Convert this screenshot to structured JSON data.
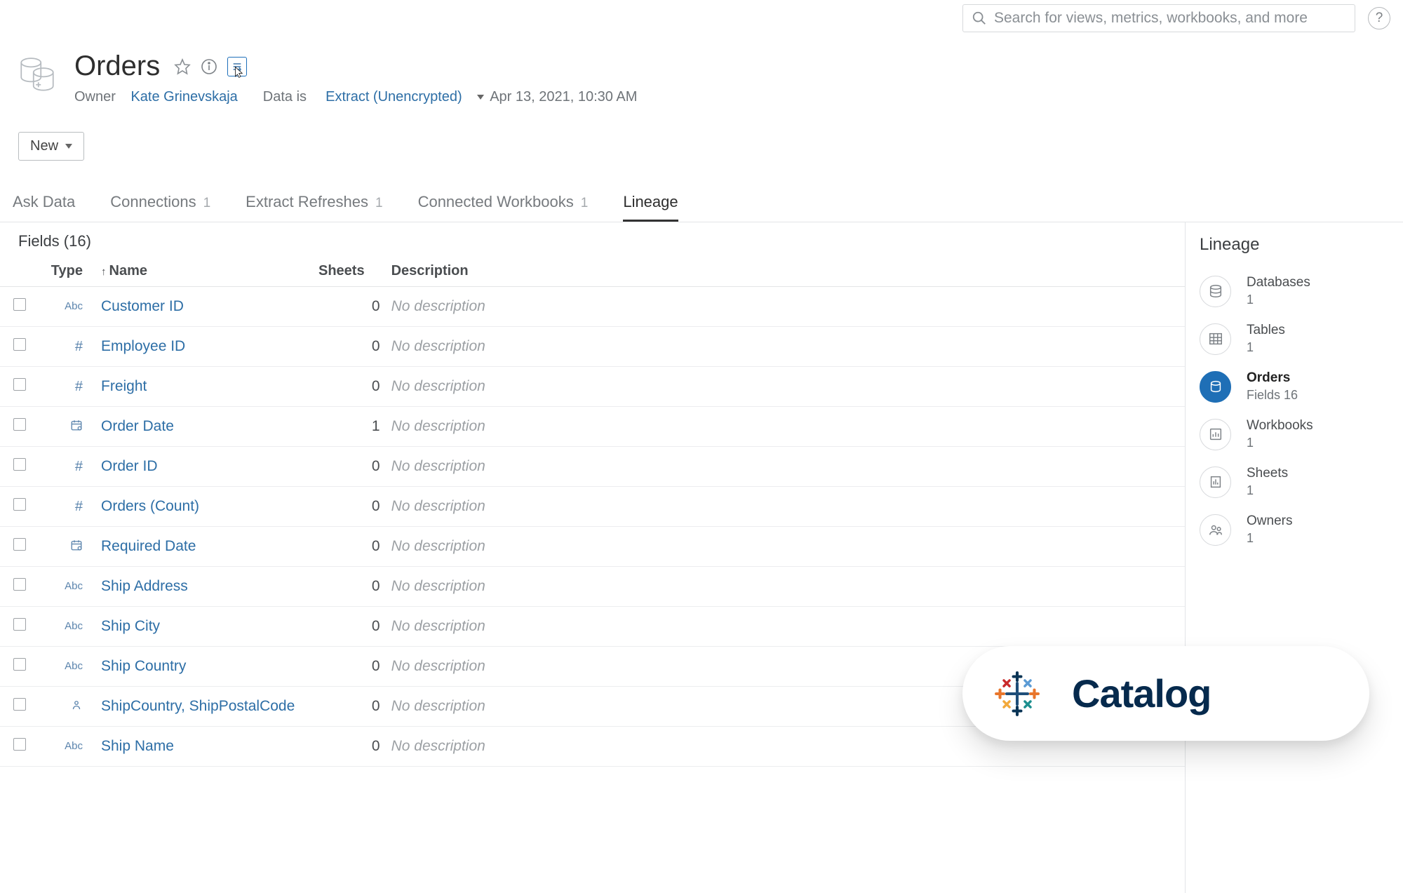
{
  "search": {
    "placeholder": "Search for views, metrics, workbooks, and more"
  },
  "header": {
    "title": "Orders",
    "owner_label": "Owner",
    "owner_name": "Kate Grinevskaja",
    "data_is_label": "Data is",
    "extract_label": "Extract (Unencrypted)",
    "timestamp": "Apr 13, 2021, 10:30 AM"
  },
  "toolbar": {
    "new_label": "New"
  },
  "tabs": [
    {
      "label": "Ask Data",
      "count": ""
    },
    {
      "label": "Connections",
      "count": "1"
    },
    {
      "label": "Extract Refreshes",
      "count": "1"
    },
    {
      "label": "Connected Workbooks",
      "count": "1"
    },
    {
      "label": "Lineage",
      "count": "",
      "active": true
    }
  ],
  "fields_header": "Fields (16)",
  "columns": {
    "type": "Type",
    "name": "Name",
    "sheets": "Sheets",
    "description": "Description"
  },
  "fields": [
    {
      "type": "Abc",
      "name": "Customer ID",
      "sheets": "0",
      "desc": "No description"
    },
    {
      "type": "#",
      "name": "Employee ID",
      "sheets": "0",
      "desc": "No description"
    },
    {
      "type": "#",
      "name": "Freight",
      "sheets": "0",
      "desc": "No description"
    },
    {
      "type": "date",
      "name": "Order Date",
      "sheets": "1",
      "desc": "No description"
    },
    {
      "type": "#",
      "name": "Order ID",
      "sheets": "0",
      "desc": "No description"
    },
    {
      "type": "#",
      "name": "Orders (Count)",
      "sheets": "0",
      "desc": "No description"
    },
    {
      "type": "date",
      "name": "Required Date",
      "sheets": "0",
      "desc": "No description"
    },
    {
      "type": "Abc",
      "name": "Ship Address",
      "sheets": "0",
      "desc": "No description"
    },
    {
      "type": "Abc",
      "name": "Ship City",
      "sheets": "0",
      "desc": "No description"
    },
    {
      "type": "Abc",
      "name": "Ship Country",
      "sheets": "0",
      "desc": "No description"
    },
    {
      "type": "geo",
      "name": "ShipCountry, ShipPostalCode",
      "sheets": "0",
      "desc": "No description"
    },
    {
      "type": "Abc",
      "name": "Ship Name",
      "sheets": "0",
      "desc": "No description"
    }
  ],
  "lineage_panel": {
    "title": "Lineage",
    "items": [
      {
        "icon": "database",
        "label": "Databases",
        "count": "1"
      },
      {
        "icon": "table",
        "label": "Tables",
        "count": "1"
      },
      {
        "icon": "datasource",
        "label": "Orders",
        "count": "Fields 16",
        "active": true
      },
      {
        "icon": "workbook",
        "label": "Workbooks",
        "count": "1"
      },
      {
        "icon": "sheet",
        "label": "Sheets",
        "count": "1"
      },
      {
        "icon": "owners",
        "label": "Owners",
        "count": "1"
      }
    ]
  },
  "catalog_overlay": {
    "word": "Catalog"
  }
}
